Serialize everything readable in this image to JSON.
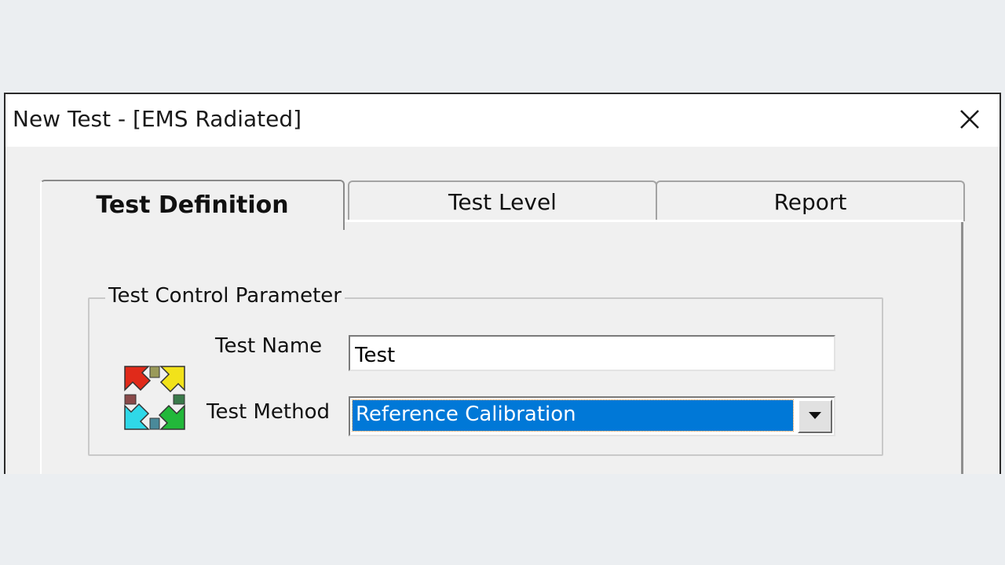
{
  "window": {
    "title": "New Test - [EMS Radiated]",
    "close_icon": "close-icon"
  },
  "tabs": [
    {
      "label": "Test Definition",
      "active": true
    },
    {
      "label": "Test Level",
      "active": false
    },
    {
      "label": "Report",
      "active": false
    }
  ],
  "group": {
    "title": "Test Control Parameter",
    "icon": "four-arrows-icon",
    "test_name_label": "Test Name",
    "test_name_value": "Test",
    "test_method_label": "Test Method",
    "test_method_value": "Reference Calibration",
    "dropdown_icon": "chevron-down-icon"
  },
  "colors": {
    "selection": "#0078d7",
    "background": "#ebeef1",
    "dialog": "#f0f0f0"
  }
}
